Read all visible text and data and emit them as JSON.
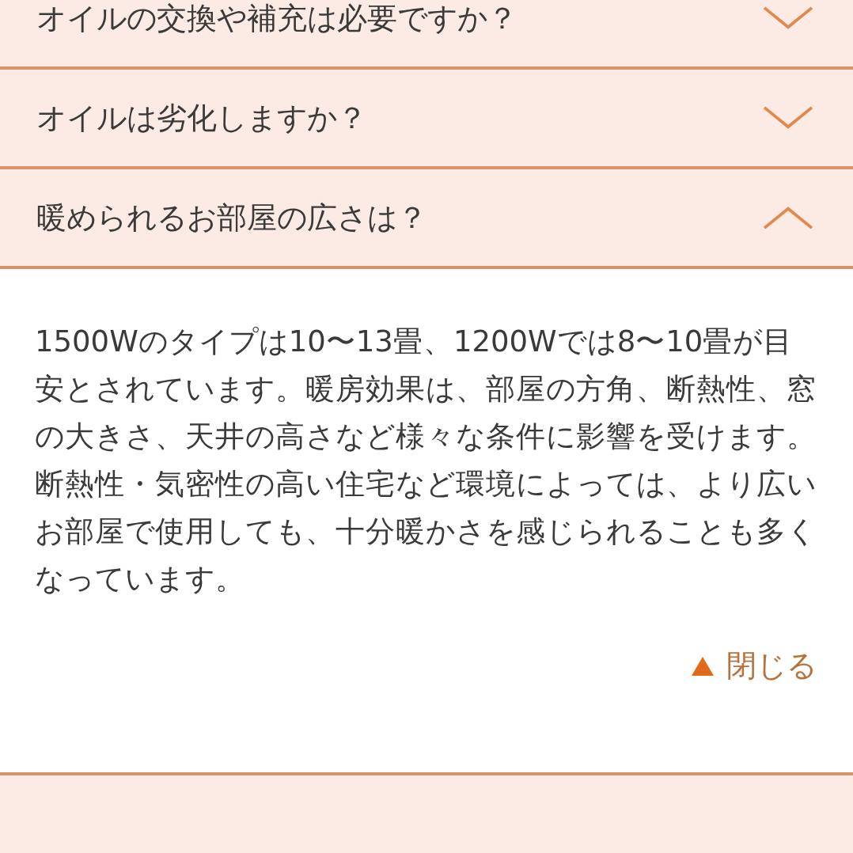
{
  "faq": [
    {
      "question": "オイルの交換や補充は必要ですか？",
      "expanded": false
    },
    {
      "question": "オイルは劣化しますか？",
      "expanded": false
    },
    {
      "question": "暖められるお部屋の広さは？",
      "expanded": true,
      "answer": [
        "1500Wのタイプは10〜13畳、1200Wでは8〜10畳が目安とされています。暖房効果は、部屋の方角、断熱性、窓の大きさ、天井の高さなど様々な条件に影響を受けます。",
        "断熱性・気密性の高い住宅など環境によっては、より広いお部屋で使用しても、十分暖かさを感じられることも多くなっています。"
      ],
      "close_label": "閉じる"
    }
  ]
}
